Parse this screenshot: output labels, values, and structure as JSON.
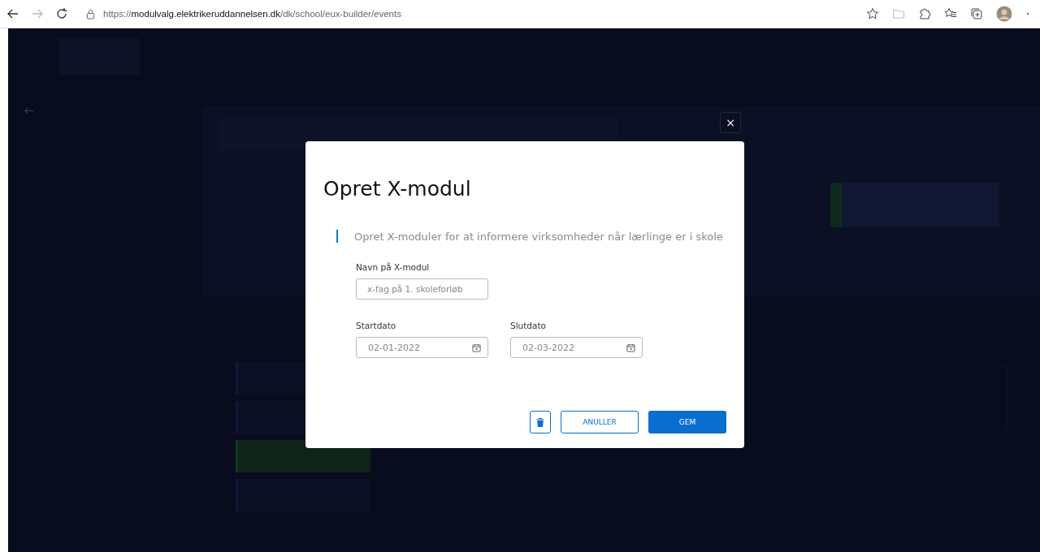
{
  "browser": {
    "url_prefix": "https://",
    "url_host": "modulvalg.elektrikeruddannelsen.dk",
    "url_path": "/dk/school/eux-builder/events"
  },
  "modal": {
    "title": "Opret X-modul",
    "description": "Opret X-moduler for at informere virksomheder når lærlinge er i skole",
    "name_label": "Navn på X-modul",
    "name_placeholder": "x-fag på 1. skoleforløb",
    "start_label": "Startdato",
    "start_value": "02-01-2022",
    "end_label": "Slutdato",
    "end_value": "02-03-2022",
    "cancel": "ANULLER",
    "save": "GEM",
    "close": "×"
  }
}
